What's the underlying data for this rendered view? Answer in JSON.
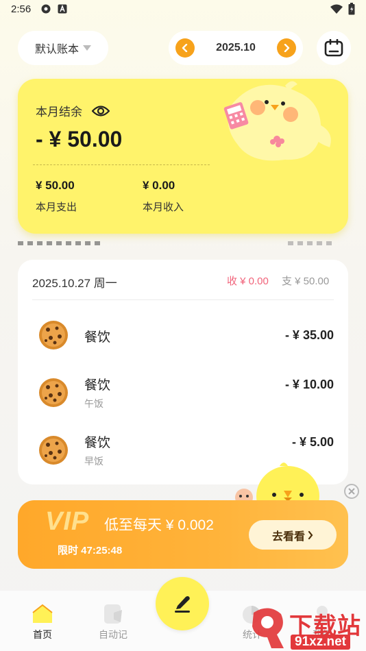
{
  "status_bar": {
    "time": "2:56"
  },
  "header": {
    "ledger_label": "默认账本",
    "month": "2025.10"
  },
  "balance": {
    "label": "本月结余",
    "amount": "- ¥ 50.00",
    "expense_amount": "¥ 50.00",
    "expense_label": "本月支出",
    "income_amount": "¥ 0.00",
    "income_label": "本月收入"
  },
  "day_group": {
    "date": "2025.10.27 周一",
    "income": "收 ¥ 0.00",
    "expense": "支 ¥ 50.00",
    "transactions": [
      {
        "category": "餐饮",
        "note": "",
        "amount": "- ¥ 35.00"
      },
      {
        "category": "餐饮",
        "note": "午饭",
        "amount": "- ¥ 10.00"
      },
      {
        "category": "餐饮",
        "note": "早饭",
        "amount": "- ¥ 5.00"
      }
    ]
  },
  "vip": {
    "title": "VIP",
    "text": "低至每天 ¥ 0.002",
    "timer": "限时 47:25:48",
    "button": "去看看"
  },
  "nav": {
    "items": [
      {
        "label": "首页"
      },
      {
        "label": "自动记"
      },
      {
        "label": "统计"
      },
      {
        "label": "我的"
      }
    ]
  },
  "watermark": {
    "text": "下载站",
    "url_text": "91xz.net"
  },
  "colors": {
    "accent_orange": "#f7a21b",
    "card_yellow": "#fff36b",
    "income_pink": "#f1637a"
  }
}
